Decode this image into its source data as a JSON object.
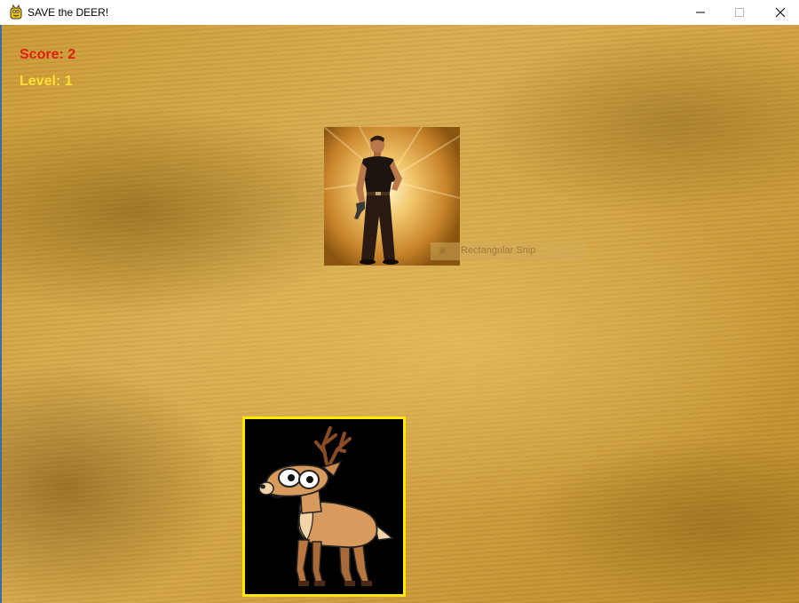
{
  "window": {
    "title": "SAVE the DEER!",
    "controls": [
      "minimize",
      "maximize",
      "close"
    ]
  },
  "hud": {
    "score_text": "Score: 2",
    "level_text": "Level: 1"
  },
  "overlay": {
    "snip_label": "Rectangular Snip"
  },
  "sprites": {
    "hunter": "hunter-with-gun",
    "deer": "cartoon-deer"
  },
  "colors": {
    "score": "#e01f0f",
    "level": "#ffe033",
    "deer_border": "#ffe800",
    "background": "#cfa040"
  }
}
